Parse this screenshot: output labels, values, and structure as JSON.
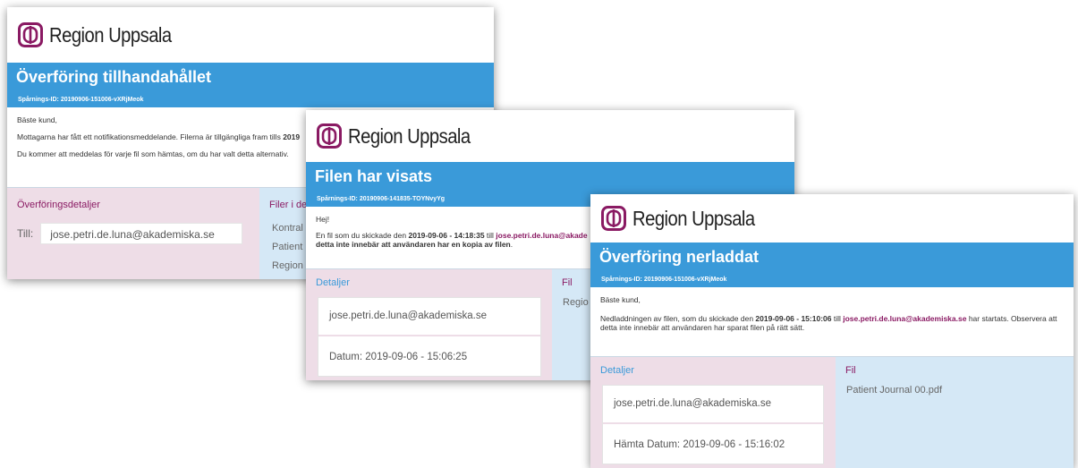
{
  "brand": {
    "name": "Region Uppsala",
    "logo_icon": "region-uppsala-logo-icon",
    "accent": "#3a9ad9",
    "brand_purple": "#8a1a63"
  },
  "email1": {
    "title": "Överföring tillhandahållet",
    "tracking": "Spårnings-ID: 20190906-151006-vXRjMeok",
    "greeting": "Bäste kund,",
    "line1_start": "Mottagarna har fått ett notifikationsmeddelande. Filerna är tillgängliga fram tills ",
    "line1_bold": "2019",
    "line2": "Du kommer att meddelas för varje fil som hämtas, om du har valt detta alternativ.",
    "left_heading": "Överföringsdetaljer",
    "to_label": "Till:",
    "to_value": "jose.petri.de.luna@akademiska.se",
    "right_heading": "Filer i de",
    "files": [
      "Kontral",
      "Patient",
      "Region"
    ]
  },
  "email2": {
    "title": "Filen har visats",
    "tracking": "Spårnings-ID: 20190906-141835-TOYNvyYg",
    "greeting": "Hej!",
    "line1_start": "En fil som du skickade den ",
    "line1_date": "2019-09-06 - 14:18:35",
    "line1_mid": " till ",
    "line1_email": "jose.petri.de.luna@akade",
    "line2_bold": "detta inte innebär att användaren har en kopia av filen",
    "line2_end": ".",
    "left_heading": "Detaljer",
    "email_value": "jose.petri.de.luna@akademiska.se",
    "date_label": "Datum:",
    "date_value": "2019-09-06 - 15:06:25",
    "right_heading": "Fil",
    "file": "Regio"
  },
  "email3": {
    "title": "Överföring nerladdat",
    "tracking": "Spårnings-ID: 20190906-151006-vXRjMeok",
    "greeting": "Bäste kund,",
    "line1_start": "Nedladdningen av filen, som du skickade den ",
    "line1_date": "2019-09-06 - 15:10:06",
    "line1_mid": " till ",
    "line1_email": "jose.petri.de.luna@akademiska.se",
    "line1_end": " har startats. Observera att",
    "line2": "detta inte innebär att användaren har sparat filen på rätt sätt.",
    "left_heading": "Detaljer",
    "email_value": "jose.petri.de.luna@akademiska.se",
    "date_label": "Hämta Datum:",
    "date_value": "2019-09-06 - 15:16:02",
    "right_heading": "Fil",
    "file": "Patient Journal 00.pdf"
  }
}
